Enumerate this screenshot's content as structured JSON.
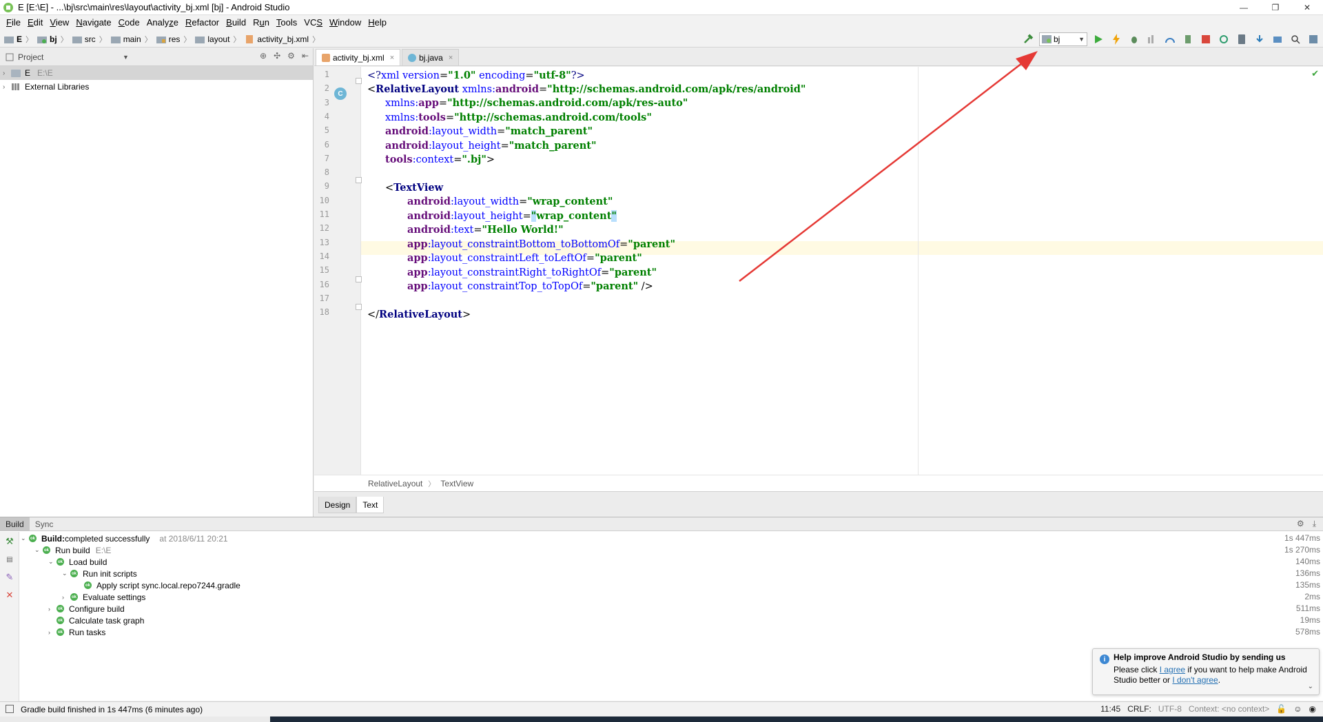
{
  "window": {
    "title": "E [E:\\E] - ...\\bj\\src\\main\\res\\layout\\activity_bj.xml [bj] - Android Studio",
    "controls": [
      "—",
      "❐",
      "✕"
    ]
  },
  "menu": [
    {
      "pre": "",
      "u": "F",
      "post": "ile"
    },
    {
      "pre": "",
      "u": "E",
      "post": "dit"
    },
    {
      "pre": "",
      "u": "V",
      "post": "iew"
    },
    {
      "pre": "",
      "u": "N",
      "post": "avigate"
    },
    {
      "pre": "",
      "u": "C",
      "post": "ode"
    },
    {
      "pre": "Analy",
      "u": "z",
      "post": "e"
    },
    {
      "pre": "",
      "u": "R",
      "post": "efactor"
    },
    {
      "pre": "",
      "u": "B",
      "post": "uild"
    },
    {
      "pre": "R",
      "u": "u",
      "post": "n"
    },
    {
      "pre": "",
      "u": "T",
      "post": "ools"
    },
    {
      "pre": "VC",
      "u": "S",
      "post": ""
    },
    {
      "pre": "",
      "u": "W",
      "post": "indow"
    },
    {
      "pre": "",
      "u": "H",
      "post": "elp"
    }
  ],
  "breadcrumb": [
    "E",
    "bj",
    "src",
    "main",
    "res",
    "layout",
    "activity_bj.xml"
  ],
  "run_config": "bj",
  "project_panel": {
    "title": "Project",
    "tree": [
      {
        "label": "E",
        "path": "E:\\E"
      },
      {
        "label": "External Libraries",
        "path": ""
      }
    ]
  },
  "editor_tabs": [
    {
      "label": "activity_bj.xml",
      "close": "×"
    },
    {
      "label": "bj.java",
      "close": "×"
    }
  ],
  "code": {
    "line_numbers": [
      "1",
      "2",
      "3",
      "4",
      "5",
      "6",
      "7",
      "8",
      "9",
      "10",
      "11",
      "12",
      "13",
      "14",
      "15",
      "16",
      "17",
      "18"
    ],
    "l1": {
      "a": "<?",
      "b": "xml version",
      "c": "=",
      "d": "\"1.0\"",
      "e": " encoding",
      "f": "=",
      "g": "\"utf-8\"",
      "h": "?>"
    },
    "l2": {
      "a": "<",
      "b": "RelativeLayout",
      "c": " xmlns:",
      "d": "android",
      "e": "=",
      "f": "\"http://schemas.android.com/apk/res/android\""
    },
    "l3": {
      "a": "xmlns:",
      "b": "app",
      "c": "=",
      "d": "\"http://schemas.android.com/apk/res-auto\""
    },
    "l4": {
      "a": "xmlns:",
      "b": "tools",
      "c": "=",
      "d": "\"http://schemas.android.com/tools\""
    },
    "l5": {
      "a": "android",
      "b": ":layout_width",
      "c": "=",
      "d": "\"match_parent\""
    },
    "l6": {
      "a": "android",
      "b": ":layout_height",
      "c": "=",
      "d": "\"match_parent\""
    },
    "l7": {
      "a": "tools",
      "b": ":context",
      "c": "=",
      "d": "\".bj\"",
      "e": ">"
    },
    "l9": {
      "a": "<",
      "b": "TextView"
    },
    "l10": {
      "a": "android",
      "b": ":layout_width",
      "c": "=",
      "d": "\"wrap_content\""
    },
    "l11": {
      "a": "android",
      "b": ":layout_height",
      "c": "=",
      "d1": "\"",
      "d2": "wrap_content",
      "d3": "\""
    },
    "l12": {
      "a": "android",
      "b": ":text",
      "c": "=",
      "d": "\"Hello World!\""
    },
    "l13": {
      "a": "app",
      "b": ":layout_constraintBottom_toBottomOf",
      "c": "=",
      "d": "\"parent\""
    },
    "l14": {
      "a": "app",
      "b": ":layout_constraintLeft_toLeftOf",
      "c": "=",
      "d": "\"parent\""
    },
    "l15": {
      "a": "app",
      "b": ":layout_constraintRight_toRightOf",
      "c": "=",
      "d": "\"parent\""
    },
    "l16": {
      "a": "app",
      "b": ":layout_constraintTop_toTopOf",
      "c": "=",
      "d": "\"parent\"",
      "e": " />"
    },
    "l18": {
      "a": "</",
      "b": "RelativeLayout",
      "c": ">"
    },
    "gutter_badge": "C"
  },
  "editor_breadcrumb": [
    "RelativeLayout",
    "TextView"
  ],
  "design_tabs": [
    "Design",
    "Text"
  ],
  "build_panel": {
    "tabs": [
      "Build",
      "Sync"
    ],
    "rows": [
      {
        "label": "Build:",
        "rest": " completed successfully",
        "extra": "at 2018/6/11 20:21",
        "time": "1s 447ms"
      },
      {
        "label": "Run build",
        "extra": "E:\\E",
        "time": "1s 270ms"
      },
      {
        "label": "Load build",
        "time": "140ms"
      },
      {
        "label": "Run init scripts",
        "time": "136ms"
      },
      {
        "label": "Apply script sync.local.repo7244.gradle",
        "time": "135ms"
      },
      {
        "label": "Evaluate settings",
        "time": "2ms"
      },
      {
        "label": "Configure build",
        "time": "511ms"
      },
      {
        "label": "Calculate task graph",
        "time": "19ms"
      },
      {
        "label": "Run tasks",
        "time": "578ms"
      }
    ],
    "ok_badge": "ok"
  },
  "notification": {
    "title": "Help improve Android Studio by sending us",
    "body_pre": "Please click ",
    "agree": "I agree",
    "body_mid": " if you want to help make Android Studio better or ",
    "disagree": "I don't agree",
    "body_post": "."
  },
  "status": {
    "message": "Gradle build finished in 1s 447ms (6 minutes ago)",
    "position": "11:45",
    "line_sep": "CRLF:",
    "encoding": "UTF-8",
    "context": "Context: <no context>"
  },
  "colors": {
    "tag": "#000080",
    "attribute": "#0000ff",
    "namespace": "#660e7a",
    "string": "#008000",
    "annotation_arrow": "#e53935",
    "current_line": "#fffae3"
  }
}
